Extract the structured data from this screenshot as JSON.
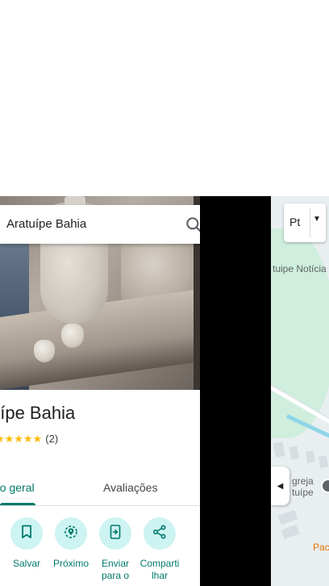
{
  "search": {
    "query": "Aratuípe Bahia"
  },
  "place": {
    "title": "uípe Bahia",
    "stars": "★★★★★",
    "review_count": "(2)"
  },
  "tabs": [
    {
      "label": "ão geral",
      "active": true
    },
    {
      "label": "Avaliações",
      "active": false
    }
  ],
  "actions": [
    {
      "label": "Salvar",
      "icon": "bookmark-icon"
    },
    {
      "label": "Próximo",
      "icon": "nearby-icon"
    },
    {
      "label": "Enviar para o",
      "icon": "send-to-phone-icon"
    },
    {
      "label": "Compartilhar",
      "icon": "share-icon"
    }
  ],
  "action_labels": {
    "save": "Salvar",
    "nearby": "Próximo",
    "send_line1": "Enviar",
    "send_line2": "para o",
    "send_line3": "…",
    "share_line1": "Comparti",
    "share_line2": "lhar"
  },
  "map": {
    "label_top": "tuipe Notícia",
    "label_church_1": "greja",
    "label_church_2": "tuípe",
    "label_bottom": "Pac",
    "layer_button_label": "Pt"
  },
  "colors": {
    "accent": "#00796b",
    "action_circle": "#cdf3f2",
    "star": "#fbbc04"
  }
}
